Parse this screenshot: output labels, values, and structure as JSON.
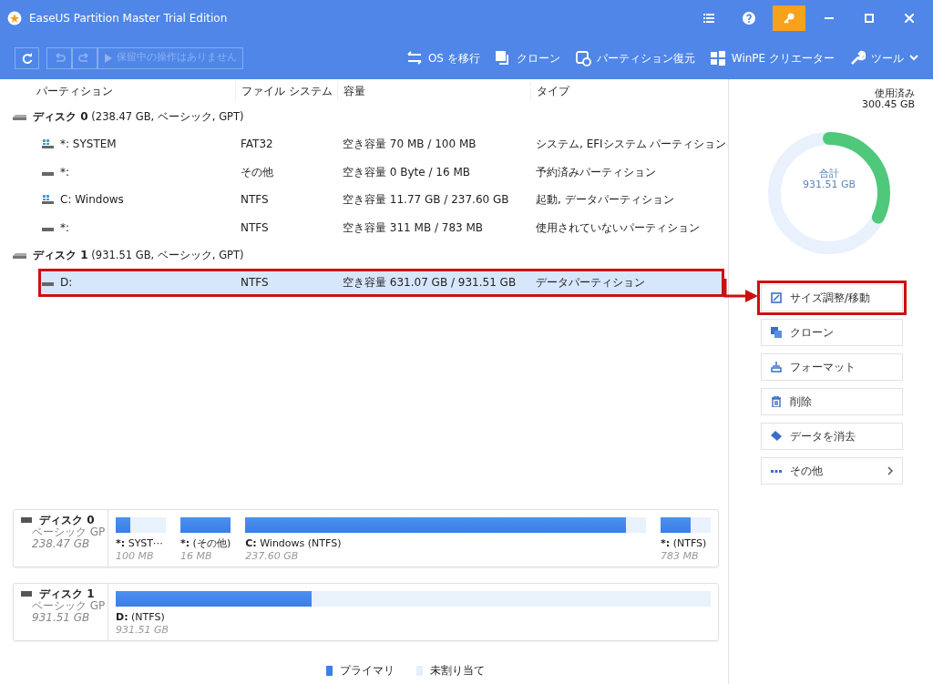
{
  "window": {
    "title": "EaseUS Partition Master Trial Edition"
  },
  "toolbar": {
    "undo_redo_disabled": true,
    "pending": "保留中の操作はありません",
    "actions": [
      {
        "kind": "migrate",
        "label": "OS を移行"
      },
      {
        "kind": "clone",
        "label": "クローン"
      },
      {
        "kind": "recover",
        "label": "パーティション復元"
      },
      {
        "kind": "winpe",
        "label": "WinPE クリエーター"
      },
      {
        "kind": "tools",
        "label": "ツール"
      }
    ]
  },
  "table": {
    "columns": [
      "パーティション",
      "ファイル システム",
      "容量",
      "タイプ"
    ],
    "disks": [
      {
        "name": "ディスク 0",
        "info": "(238.47 GB, ベーシック, GPT)",
        "partitions": [
          {
            "kind": "system",
            "name": "*: SYSTEM",
            "fs": "FAT32",
            "capacity": "空き容量 70 MB / 100 MB",
            "type": "システム, EFIシステム パーティション",
            "selected": false
          },
          {
            "kind": "plain",
            "name": "*:",
            "fs": "その他",
            "capacity": "空き容量 0 Byte / 16 MB",
            "type": "予約済みパーティション",
            "selected": false
          },
          {
            "kind": "system",
            "name": "C: Windows",
            "fs": "NTFS",
            "capacity": "空き容量 11.77 GB / 237.60 GB",
            "type": "起動, データパーティション",
            "selected": false
          },
          {
            "kind": "plain",
            "name": "*:",
            "fs": "NTFS",
            "capacity": "空き容量 311 MB / 783 MB",
            "type": "使用されていないパーティション",
            "selected": false
          }
        ]
      },
      {
        "name": "ディスク 1",
        "info": "(931.51 GB, ベーシック, GPT)",
        "partitions": [
          {
            "kind": "plain",
            "name": "D:",
            "fs": "NTFS",
            "capacity": "空き容量 631.07 GB / 931.51 GB",
            "type": "データパーティション",
            "selected": true
          }
        ]
      }
    ]
  },
  "usage": {
    "used_label": "使用済み",
    "used": "300.45 GB",
    "total_label": "合計",
    "total": "931.51 GB",
    "level": 0.3225
  },
  "operations": [
    {
      "kind": "resize",
      "label": "サイズ調整/移動",
      "highlighted": true
    },
    {
      "kind": "clone",
      "label": "クローン",
      "highlighted": false
    },
    {
      "kind": "format",
      "label": "フォーマット",
      "highlighted": false
    },
    {
      "kind": "delete",
      "label": "削除",
      "highlighted": false
    },
    {
      "kind": "wipe",
      "label": "データを消去",
      "highlighted": false
    },
    {
      "kind": "more",
      "label": "その他",
      "highlighted": false
    }
  ],
  "disk_map": [
    {
      "name": "ディスク 0",
      "type": "ベーシック GP",
      "size": "238.47 GB",
      "partitions": [
        {
          "kind": "small",
          "letter": "*:",
          "label": "SYST⋯",
          "size": "100 MB",
          "level": 0.3
        },
        {
          "kind": "small",
          "letter": "*:",
          "label": "(その他)",
          "size": "16 MB",
          "level": 1
        },
        {
          "kind": "large",
          "letter": "C:",
          "label": "Windows (NTFS)",
          "size": "237.60 GB",
          "level": 0.95
        },
        {
          "kind": "small",
          "letter": "*:",
          "label": "(NTFS)",
          "size": "783 MB",
          "level": 0.6
        }
      ]
    },
    {
      "name": "ディスク 1",
      "type": "ベーシック GP",
      "size": "931.51 GB",
      "partitions": [
        {
          "kind": "large",
          "letter": "D:",
          "label": "(NTFS)",
          "size": "931.51 GB",
          "level": 0.33
        }
      ]
    }
  ],
  "legend": [
    "プライマリ",
    "未割り当て"
  ]
}
